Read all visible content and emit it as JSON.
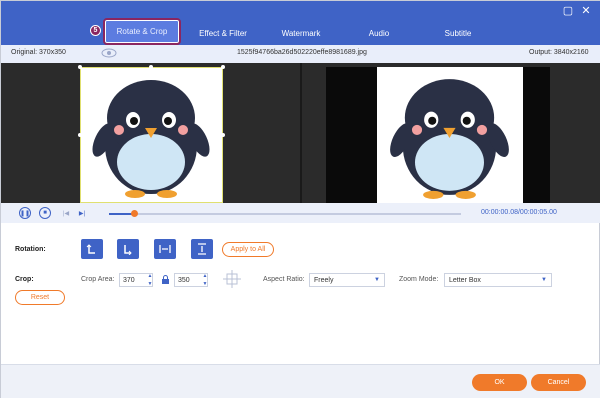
{
  "tabs": [
    {
      "label": "Rotate & Crop"
    },
    {
      "label": "Effect & Filter"
    },
    {
      "label": "Watermark"
    },
    {
      "label": "Audio"
    },
    {
      "label": "Subtitle"
    }
  ],
  "step_badge": "5",
  "window_controls": {
    "restore": "▢",
    "close": "✕"
  },
  "info": {
    "original": "Original: 370x350",
    "filename": "1525f94766ba26d502220effe8981689.jpg",
    "output": "Output: 3840x2160"
  },
  "playback": {
    "timecode": "00:00:00.08/00:00:05.00",
    "progress": 0.07
  },
  "rotation": {
    "label": "Rotation:",
    "apply_all": "Apply to All"
  },
  "crop": {
    "label": "Crop:",
    "area_label": "Crop Area:",
    "width": "370",
    "height": "350",
    "aspect_label": "Aspect Ratio:",
    "aspect_value": "Freely",
    "zoom_label": "Zoom Mode:",
    "zoom_value": "Letter Box",
    "reset": "Reset"
  },
  "footer": {
    "ok": "OK",
    "cancel": "Cancel"
  },
  "colors": {
    "primary": "#3f63c6",
    "accent": "#f07a2a",
    "highlight": "#8a2660"
  }
}
